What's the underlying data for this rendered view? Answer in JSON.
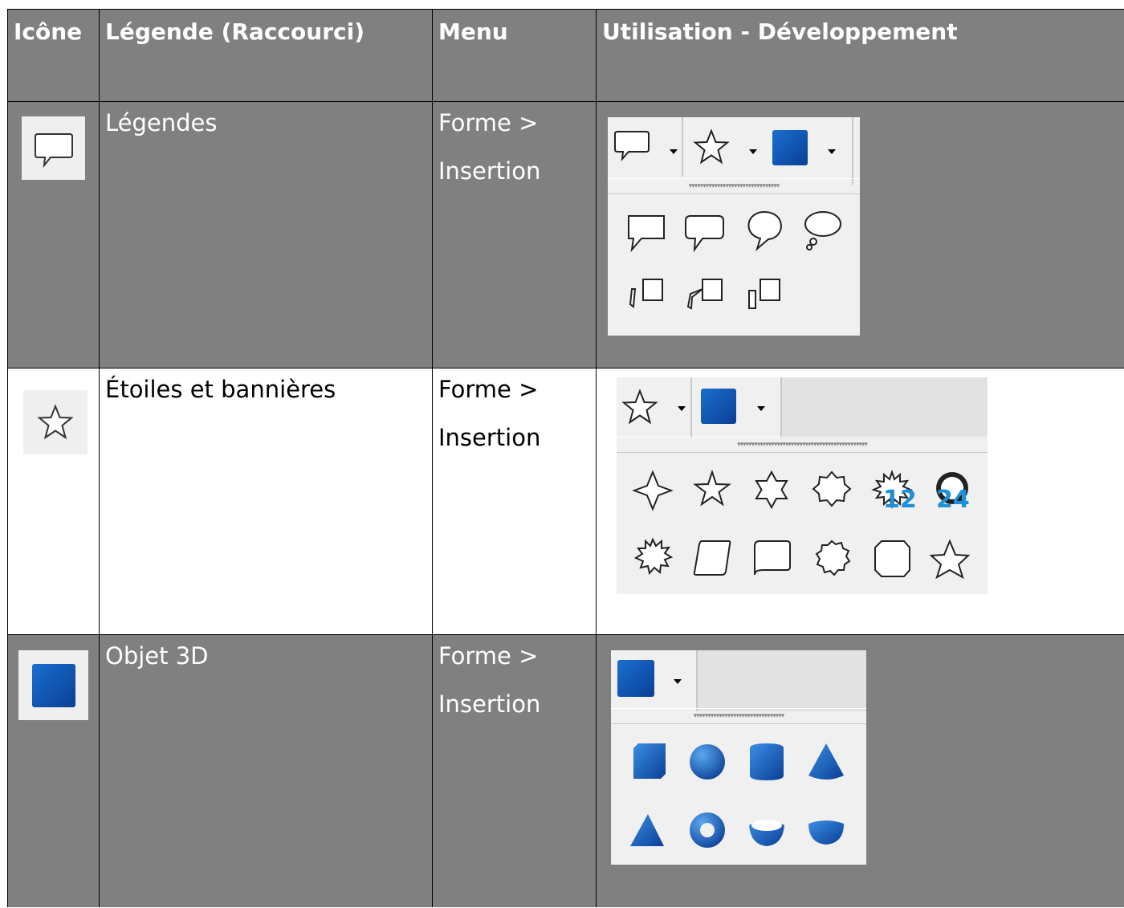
{
  "header": {
    "col_icon": "Icône",
    "col_legend": "Légende (Raccourci)",
    "col_menu": "Menu",
    "col_usage": "Utilisation  - Développement"
  },
  "rows": [
    {
      "icon": "speech-bubble-icon",
      "legend": "Légendes",
      "menu_line1": "Forme >",
      "menu_line2": "Insertion",
      "panel_items": [
        "rectangular-callout-icon",
        "rounded-rectangular-callout-icon",
        "round-callout-icon",
        "cloud-callout-icon",
        "line-callout-1-icon",
        "line-callout-2-icon",
        "line-callout-3-icon"
      ]
    },
    {
      "icon": "star-icon",
      "legend": "Étoiles et bannières",
      "menu_line1": "Forme >",
      "menu_line2": "Insertion",
      "panel_items": [
        "4-point-star-icon",
        "5-point-star-icon",
        "6-point-star-icon",
        "8-point-star-icon",
        "12-point-star-icon",
        "24-point-star-icon",
        "explosion-icon",
        "vertical-scroll-icon",
        "horizontal-scroll-icon",
        "signet-icon",
        "doorplate-icon",
        "concave-star-icon"
      ],
      "badge_12": "12",
      "badge_24": "24"
    },
    {
      "icon": "cube-3d-icon",
      "legend": "Objet 3D",
      "menu_line1": "Forme >",
      "menu_line2": "Insertion",
      "panel_items": [
        "cube-icon",
        "sphere-icon",
        "cylinder-icon",
        "cone-icon",
        "pyramid-icon",
        "torus-icon",
        "shell-icon",
        "half-sphere-icon"
      ]
    }
  ],
  "colors": {
    "gray_row": "#808080",
    "white_row": "#ffffff",
    "accent_3d": "#1a6fd0",
    "badge": "#1e90d8"
  }
}
